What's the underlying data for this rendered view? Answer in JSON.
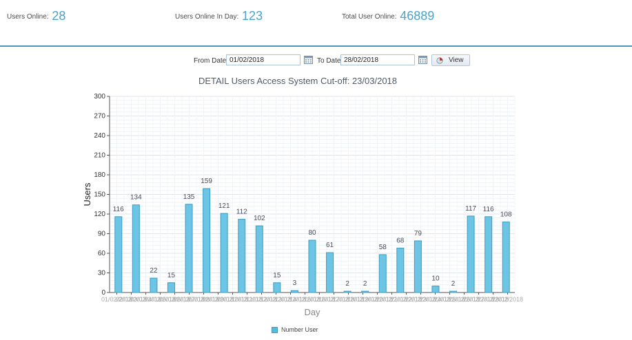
{
  "stats": {
    "users_online_label": "Users Online:",
    "users_online_value": "28",
    "users_online_day_label": "Users Online In Day:",
    "users_online_day_value": "123",
    "total_user_online_label": "Total User Online:",
    "total_user_online_value": "46889"
  },
  "filter": {
    "from_label": "From Date",
    "from_value": "01/02/2018",
    "to_label": "To Date",
    "to_value": "28/02/2018",
    "view_label": "View"
  },
  "icons": {
    "calendar": "calendar-icon",
    "view": "chart-pie-icon"
  },
  "colors": {
    "accent": "#4aa3c8",
    "bar_fill": "#6cc5e4",
    "bar_stroke": "#3e9cc0",
    "divider": "#4a96b8"
  },
  "chart_data": {
    "type": "bar",
    "title": "DETAIL Users Access System Cut-off: 23/03/2018",
    "xlabel": "Day",
    "ylabel": "Users",
    "ylim": [
      0,
      300
    ],
    "yticks": [
      0,
      30,
      60,
      90,
      120,
      150,
      180,
      210,
      240,
      270,
      300
    ],
    "grid": true,
    "legend_position": "bottom-center",
    "categories": [
      "01/02/2018",
      "02/02/2018",
      "03/02/2018",
      "04/02/2018",
      "05/02/2018",
      "06/02/2018",
      "07/02/2018",
      "08/02/2018",
      "09/02/2018",
      "10/02/2018",
      "11/02/2018",
      "12/02/2018",
      "13/02/2018",
      "14/02/2018",
      "15/02/2018",
      "16/02/2018",
      "17/02/2018",
      "18/02/2018",
      "19/02/2018",
      "20/02/2018",
      "21/02/2018",
      "22/02/2018",
      "23/02/2018",
      "24/02/2018",
      "25/02/2018",
      "26/02/2018",
      "27/02/2018",
      "28/02/2018"
    ],
    "series": [
      {
        "name": "Number User",
        "values": [
          116,
          134,
          22,
          15,
          135,
          159,
          121,
          112,
          102,
          15,
          3,
          80,
          61,
          2,
          2,
          58,
          68,
          79,
          10,
          2,
          117,
          116,
          108
        ]
      }
    ]
  }
}
